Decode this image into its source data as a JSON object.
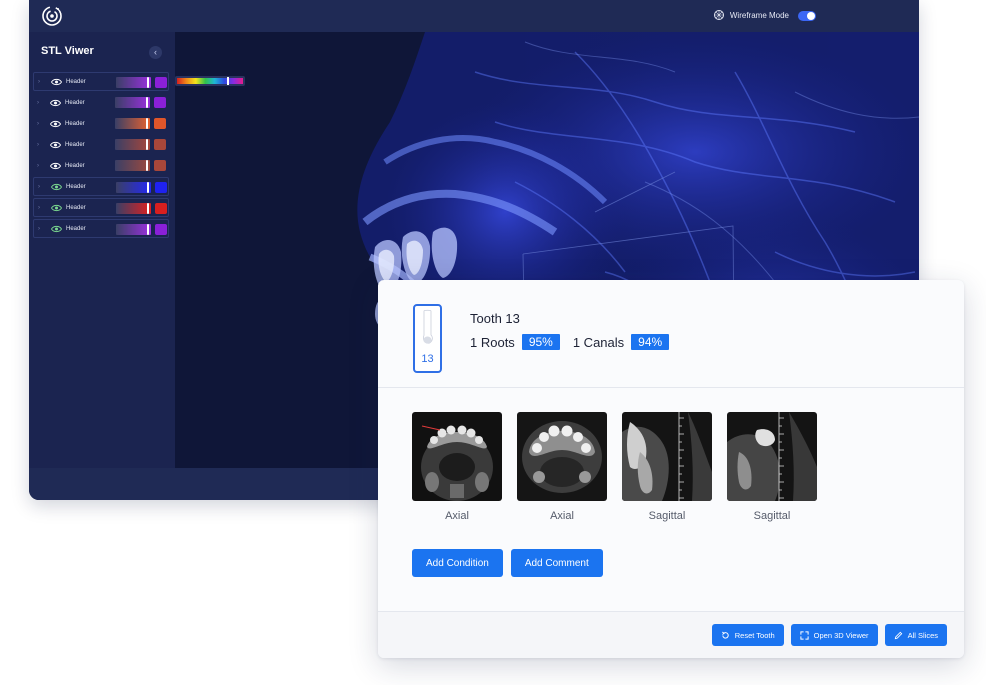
{
  "app": {
    "title": "STL Viwer",
    "wireframe_label": "Wireframe Mode",
    "wireframe_on": true,
    "collapse_glyph": "‹"
  },
  "layers": [
    {
      "label": "Header",
      "color": "#8a20d8",
      "grad_from": "#3a3f66",
      "grad_to": "#9b30e0",
      "bordered": true,
      "eye_color": "#ffffff"
    },
    {
      "label": "Header",
      "color": "#8a20d8",
      "grad_from": "#3a3f66",
      "grad_to": "#9b30e0",
      "bordered": false,
      "eye_color": "#ffffff"
    },
    {
      "label": "Header",
      "color": "#e0562a",
      "grad_from": "#3a3f66",
      "grad_to": "#e86330",
      "bordered": false,
      "eye_color": "#ffffff"
    },
    {
      "label": "Header",
      "color": "#a8473a",
      "grad_from": "#3a3f66",
      "grad_to": "#a8473a",
      "bordered": false,
      "eye_color": "#ffffff"
    },
    {
      "label": "Header",
      "color": "#a8473a",
      "grad_from": "#3a3f66",
      "grad_to": "#9e4a3e",
      "bordered": false,
      "eye_color": "#ffffff"
    },
    {
      "label": "Header",
      "color": "#1f22f0",
      "grad_from": "#3a3f66",
      "grad_to": "#2428f5",
      "bordered": true,
      "eye_color": "#7bd88f"
    },
    {
      "label": "Header",
      "color": "#d81f1f",
      "grad_from": "#3a3f66",
      "grad_to": "#e02020",
      "bordered": true,
      "eye_color": "#7bd88f"
    },
    {
      "label": "Header",
      "color": "#8a20d8",
      "grad_from": "#3a3f66",
      "grad_to": "#9b30e0",
      "bordered": true,
      "eye_color": "#7bd88f"
    }
  ],
  "tooth": {
    "number": "13",
    "title": "Tooth 13",
    "roots_label": "1 Roots",
    "roots_pct": "95%",
    "canals_label": "1 Canals",
    "canals_pct": "94%"
  },
  "slices": [
    {
      "caption": "Axial",
      "kind": "axial1"
    },
    {
      "caption": "Axial",
      "kind": "axial2"
    },
    {
      "caption": "Sagittal",
      "kind": "sag1"
    },
    {
      "caption": "Sagittal",
      "kind": "sag2"
    }
  ],
  "actions": {
    "add_condition": "Add Condition",
    "add_comment": "Add Comment"
  },
  "footer": {
    "reset": "Reset Tooth",
    "open3d": "Open 3D Viewer",
    "all_slices": "All Slices"
  },
  "colors": {
    "accent": "#1b74f0",
    "app_bg": "#0f1638",
    "sidebar_bg": "#1b2450"
  }
}
